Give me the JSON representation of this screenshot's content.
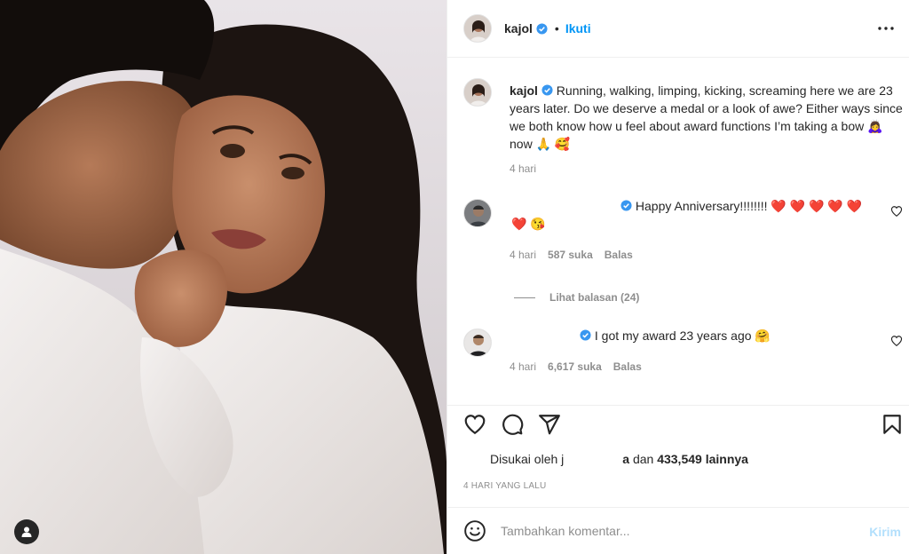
{
  "post": {
    "image_alt": "Photo of a man embracing a woman in white shirts",
    "author": {
      "username": "kajol",
      "verified": true,
      "follow_label": "Ikuti"
    },
    "caption": {
      "username": "kajol",
      "text": "Running, walking, limping, kicking, screaming here we are 23 years later. Do we deserve a medal or a look of awe? Either ways since we both know how u feel about award functions I’m taking a bow 🙇‍♀️ now 🙏 🥰",
      "time": "4 hari"
    },
    "comments": [
      {
        "username": "",
        "text_line1": "Happy Anniversary!!!!!!!! ❤️ ❤️ ❤️ ❤️ ❤️",
        "text_line2": "❤️ 😘",
        "time": "4 hari",
        "likes": "587 suka",
        "reply_label": "Balas",
        "view_replies": "Lihat balasan (24)"
      },
      {
        "username": "",
        "text": "I got my award 23 years ago 🤗",
        "time": "4 hari",
        "likes": "6,617 suka",
        "reply_label": "Balas"
      }
    ],
    "liked_by": {
      "prefix": "Disukai oleh j",
      "suffix_user": "a",
      "middle": " dan ",
      "count": "433,549 lainnya"
    },
    "timestamp": "4 HARI YANG LALU",
    "add_comment": {
      "placeholder": "Tambahkan komentar...",
      "post_label": "Kirim"
    }
  },
  "icons": [
    "heart-icon",
    "comment-icon",
    "share-icon",
    "bookmark-icon",
    "more-icon",
    "emoji-icon",
    "user-tag-icon",
    "verified-icon"
  ],
  "colors": {
    "accent": "#0095f6",
    "post_disabled": "#b2dffc",
    "like_red": "#ed4956",
    "muted": "#8e8e8e",
    "text": "#262626"
  }
}
